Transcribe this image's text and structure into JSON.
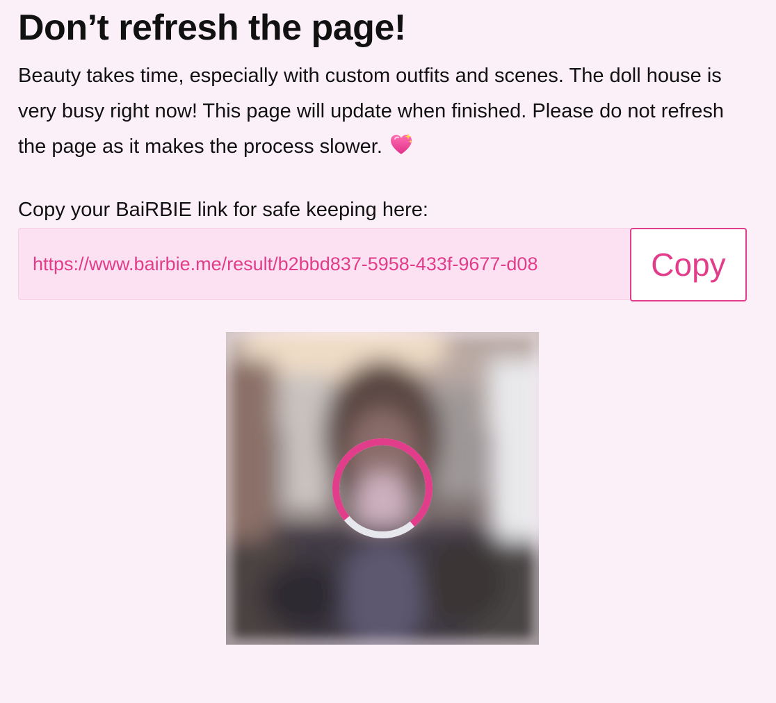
{
  "heading": "Don’t refresh the page!",
  "intro": {
    "text": "Beauty takes time, especially with custom outfits and scenes. The doll house is very busy right now! This page will update when finished. Please do not refresh the page as it makes the process slower. ",
    "emoji_icon": "sparkling-heart-icon"
  },
  "copy_section": {
    "label": "Copy your BaiRBIE link for safe keeping here:",
    "link_value": "https://www.bairbie.me/result/b2bbd837-5958-433f-9677-d08",
    "button_label": "Copy"
  },
  "preview": {
    "image": "blurred-portrait-photo",
    "spinner_icon": "loading-spinner-icon",
    "spinner_progress": 0.75
  },
  "colors": {
    "background": "#fcf0f8",
    "accent": "#e23d8a",
    "field_background": "#fbe1f1",
    "spinner_track": "#e6e8ee"
  }
}
